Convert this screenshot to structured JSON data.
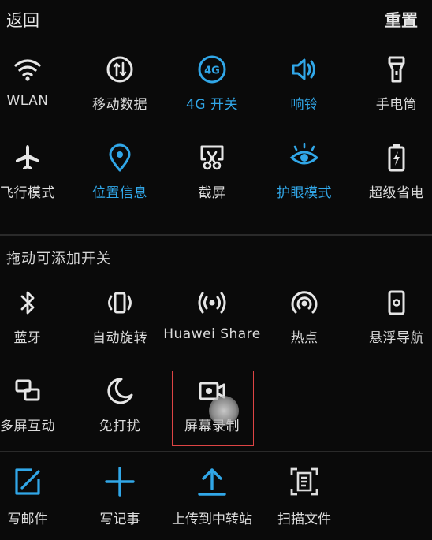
{
  "header": {
    "back_label": "返回",
    "reset_label": "重置"
  },
  "colors": {
    "active": "#31a7e8",
    "inactive": "#e6e6e6",
    "background": "#0a0a0a"
  },
  "active_toggles": [
    {
      "label": "WLAN",
      "icon": "wifi-icon",
      "on": false
    },
    {
      "label": "移动数据",
      "icon": "mobile-data-icon",
      "on": false
    },
    {
      "label": "4G 开关",
      "icon": "4g-icon",
      "on": true
    },
    {
      "label": "响铃",
      "icon": "speaker-icon",
      "on": true
    },
    {
      "label": "手电筒",
      "icon": "flashlight-icon",
      "on": false
    },
    {
      "label": "飞行模式",
      "icon": "airplane-icon",
      "on": false
    },
    {
      "label": "位置信息",
      "icon": "location-icon",
      "on": true
    },
    {
      "label": "截屏",
      "icon": "screenshot-icon",
      "on": false
    },
    {
      "label": "护眼模式",
      "icon": "eye-icon",
      "on": true
    },
    {
      "label": "超级省电",
      "icon": "battery-icon",
      "on": false
    }
  ],
  "section_title": "拖动可添加开关",
  "available_toggles": [
    {
      "label": "蓝牙",
      "icon": "bluetooth-icon"
    },
    {
      "label": "自动旋转",
      "icon": "rotate-icon"
    },
    {
      "label": "Huawei Share",
      "icon": "huawei-share-icon"
    },
    {
      "label": "热点",
      "icon": "hotspot-icon"
    },
    {
      "label": "悬浮导航",
      "icon": "floating-nav-icon"
    },
    {
      "label": "多屏互动",
      "icon": "multiscreen-icon"
    },
    {
      "label": "免打扰",
      "icon": "moon-icon"
    },
    {
      "label": "屏幕录制",
      "icon": "screen-record-icon"
    }
  ],
  "bottom_actions": [
    {
      "label": "写邮件",
      "icon": "compose-mail-icon"
    },
    {
      "label": "写记事",
      "icon": "plus-icon"
    },
    {
      "label": "上传到中转站",
      "icon": "upload-icon"
    },
    {
      "label": "扫描文件",
      "icon": "scan-document-icon"
    }
  ]
}
